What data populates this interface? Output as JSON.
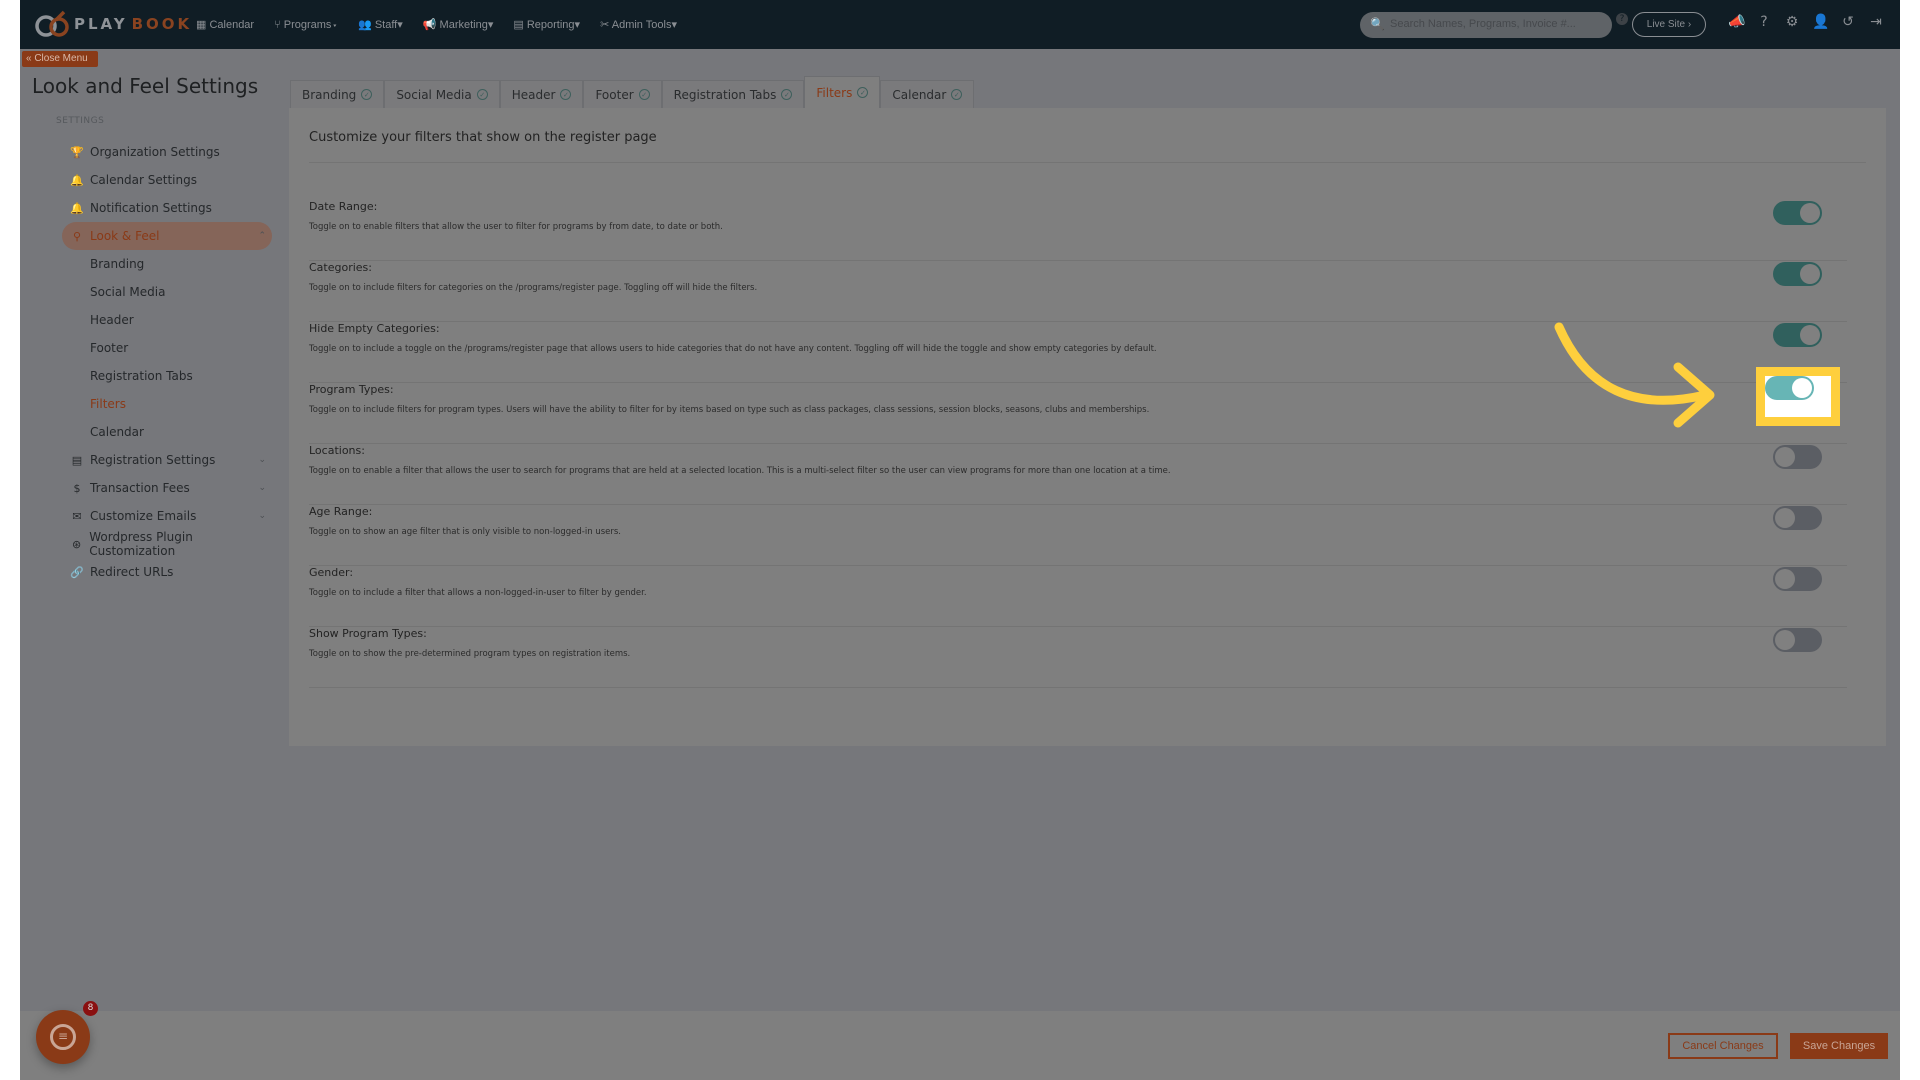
{
  "nav": {
    "brand": {
      "left": "PLAY",
      "right": "BOOK"
    },
    "menu": [
      {
        "label": "Calendar",
        "icon": "calendar-icon",
        "glyph": "▦"
      },
      {
        "label": "Programs",
        "icon": "programs-icon",
        "glyph": "⑂",
        "dropdown": true
      },
      {
        "label": "Staff",
        "icon": "staff-icon",
        "glyph": "👥",
        "dropdown": true
      },
      {
        "label": "Marketing",
        "icon": "megaphone-icon",
        "glyph": "📢",
        "dropdown": true
      },
      {
        "label": "Reporting",
        "icon": "report-icon",
        "glyph": "▤",
        "dropdown": true
      },
      {
        "label": "Admin Tools",
        "icon": "tools-icon",
        "glyph": "✂",
        "dropdown": true
      }
    ],
    "search_placeholder": "Search Names, Programs, Invoice #...",
    "live_site": "Live Site ›",
    "icons": [
      {
        "name": "announcement-icon",
        "glyph": "📣"
      },
      {
        "name": "help-icon",
        "glyph": "?"
      },
      {
        "name": "gear-icon",
        "glyph": "⚙"
      },
      {
        "name": "add-user-icon",
        "glyph": "👤"
      },
      {
        "name": "history-icon",
        "glyph": "↺"
      },
      {
        "name": "logout-icon",
        "glyph": "⇥"
      }
    ]
  },
  "close_menu": "« Close Menu",
  "page_title": "Look and Feel Settings",
  "sidebar": {
    "heading": "SETTINGS",
    "items": [
      {
        "label": "Organization Settings",
        "icon": "trophy-icon",
        "glyph": "🏆"
      },
      {
        "label": "Calendar Settings",
        "icon": "bell-icon",
        "glyph": "🔔"
      },
      {
        "label": "Notification Settings",
        "icon": "bell-icon",
        "glyph": "🔔"
      },
      {
        "label": "Look & Feel",
        "icon": "brush-icon",
        "glyph": "⚲",
        "active": true,
        "chevron": "⌃"
      },
      {
        "label": "Branding",
        "sub": true
      },
      {
        "label": "Social Media",
        "sub": true
      },
      {
        "label": "Header",
        "sub": true
      },
      {
        "label": "Footer",
        "sub": true
      },
      {
        "label": "Registration Tabs",
        "sub": true
      },
      {
        "label": "Filters",
        "sub": true,
        "selected": true
      },
      {
        "label": "Calendar",
        "sub": true
      },
      {
        "label": "Registration Settings",
        "icon": "list-icon",
        "glyph": "▤",
        "chevron": "⌄"
      },
      {
        "label": "Transaction Fees",
        "icon": "dollar-icon",
        "glyph": "$",
        "chevron": "⌄"
      },
      {
        "label": "Customize Emails",
        "icon": "envelope-icon",
        "glyph": "✉",
        "chevron": "⌄"
      },
      {
        "label": "Wordpress Plugin Customization",
        "icon": "wordpress-icon",
        "glyph": "⊛"
      },
      {
        "label": "Redirect URLs",
        "icon": "link-icon",
        "glyph": "🔗"
      }
    ]
  },
  "tabs": [
    {
      "label": "Branding"
    },
    {
      "label": "Social Media"
    },
    {
      "label": "Header"
    },
    {
      "label": "Footer"
    },
    {
      "label": "Registration Tabs"
    },
    {
      "label": "Filters",
      "active": true
    },
    {
      "label": "Calendar"
    }
  ],
  "panel_heading": "Customize your filters that show on the register page",
  "filters": [
    {
      "label": "Date Range:",
      "desc": "Toggle on to enable filters that allow the user to filter for programs by from date, to date or both.",
      "on": true
    },
    {
      "label": "Categories:",
      "desc": "Toggle on to include filters for categories on the /programs/register page. Toggling off will hide the filters.",
      "on": true
    },
    {
      "label": "Hide Empty Categories:",
      "desc": "Toggle on to include a toggle on the /programs/register page that allows users to hide categories that do not have any content. Toggling off will hide the toggle and show empty categories by default.",
      "on": true
    },
    {
      "label": "Program Types:",
      "desc": "Toggle on to include filters for program types. Users will have the ability to filter for by items based on type such as class packages, class sessions, session blocks, seasons, clubs and memberships.",
      "on": true,
      "highlighted": true
    },
    {
      "label": "Locations:",
      "desc": "Toggle on to enable a filter that allows the user to search for programs that are held at a selected location. This is a multi-select filter so the user can view programs for more than one location at a time.",
      "on": false
    },
    {
      "label": "Age Range:",
      "desc": "Toggle on to show an age filter that is only visible to non-logged-in users.",
      "on": false
    },
    {
      "label": "Gender:",
      "desc": "Toggle on to include a filter that allows a non-logged-in-user to filter by gender.",
      "on": false
    },
    {
      "label": "Show Program Types:",
      "desc": "Toggle on to show the pre-determined program types on registration items.",
      "on": false
    }
  ],
  "footer": {
    "cancel": "Cancel Changes",
    "save": "Save Changes"
  },
  "chat_badge": "8",
  "colors": {
    "accent": "#8a3a17",
    "toggle_on": "#30605d",
    "highlight": "#fecf3d",
    "toggle_highlight": "#67b5b5"
  }
}
